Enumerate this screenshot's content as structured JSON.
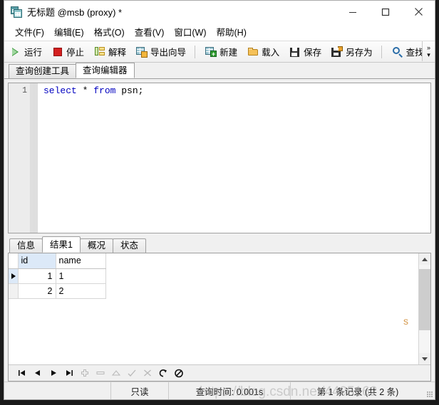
{
  "window": {
    "title": "无标题 @msb (proxy) *",
    "icon": "table-window-icon",
    "controls": {
      "minimize": "minimize-icon",
      "maximize": "maximize-icon",
      "close": "close-icon"
    }
  },
  "menubar": {
    "items": [
      {
        "label": "文件(F)",
        "name": "menu-file"
      },
      {
        "label": "编辑(E)",
        "name": "menu-edit"
      },
      {
        "label": "格式(O)",
        "name": "menu-format"
      },
      {
        "label": "查看(V)",
        "name": "menu-view"
      },
      {
        "label": "窗口(W)",
        "name": "menu-window"
      },
      {
        "label": "帮助(H)",
        "name": "menu-help"
      }
    ]
  },
  "toolbar": {
    "run": "运行",
    "stop": "停止",
    "explain": "解释",
    "export_wizard": "导出向导",
    "new": "新建",
    "load": "载入",
    "save": "保存",
    "save_as": "另存为",
    "find": "查找",
    "overflow_more": "»",
    "overflow_down": "▾"
  },
  "editor_tabs": {
    "items": [
      {
        "label": "查询创建工具",
        "active": false
      },
      {
        "label": "查询编辑器",
        "active": true
      }
    ]
  },
  "sql_editor": {
    "line_number": "1",
    "tokens": [
      {
        "text": "select",
        "type": "keyword"
      },
      {
        "text": " * ",
        "type": "operator"
      },
      {
        "text": "from",
        "type": "keyword"
      },
      {
        "text": " psn;",
        "type": "plain"
      }
    ],
    "full_text": "select * from psn;",
    "keyword_color": "#0000c0"
  },
  "result_tabs": {
    "items": [
      {
        "label": "信息",
        "active": false
      },
      {
        "label": "结果1",
        "active": true
      },
      {
        "label": "概况",
        "active": false
      },
      {
        "label": "状态",
        "active": false
      }
    ]
  },
  "result_grid": {
    "columns": [
      {
        "label": "id",
        "selected": true
      },
      {
        "label": "name",
        "selected": false
      }
    ],
    "rows": [
      {
        "current": true,
        "cells": [
          "1",
          "1"
        ]
      },
      {
        "current": false,
        "cells": [
          "2",
          "2"
        ]
      }
    ]
  },
  "grid_nav": {
    "buttons": [
      {
        "name": "first-record-button",
        "icon": "first-icon",
        "enabled": true
      },
      {
        "name": "previous-record-button",
        "icon": "previous-icon",
        "enabled": true
      },
      {
        "name": "next-record-button",
        "icon": "next-icon",
        "enabled": true
      },
      {
        "name": "last-record-button",
        "icon": "last-icon",
        "enabled": true
      },
      {
        "name": "add-record-button",
        "icon": "plus-icon",
        "enabled": false
      },
      {
        "name": "delete-record-button",
        "icon": "minus-icon",
        "enabled": false
      },
      {
        "name": "edit-record-button",
        "icon": "caret-up-icon",
        "enabled": false
      },
      {
        "name": "apply-change-button",
        "icon": "check-icon",
        "enabled": false
      },
      {
        "name": "cancel-change-button",
        "icon": "cross-icon",
        "enabled": false
      },
      {
        "name": "refresh-button",
        "icon": "refresh-icon",
        "enabled": true
      },
      {
        "name": "stop-button",
        "icon": "no-entry-icon",
        "enabled": true
      }
    ]
  },
  "statusbar": {
    "readonly": "只读",
    "query_time": "查询时间: 0.001s",
    "record_info": "第 1 条记录 (共 2 条)"
  },
  "watermarks": {
    "main": "https://blog.csdn.net/4495162",
    "edge": "s"
  },
  "scrollbar": {
    "up": "scroll-up-icon",
    "down": "scroll-down-icon",
    "thumb": "scroll-thumb"
  }
}
